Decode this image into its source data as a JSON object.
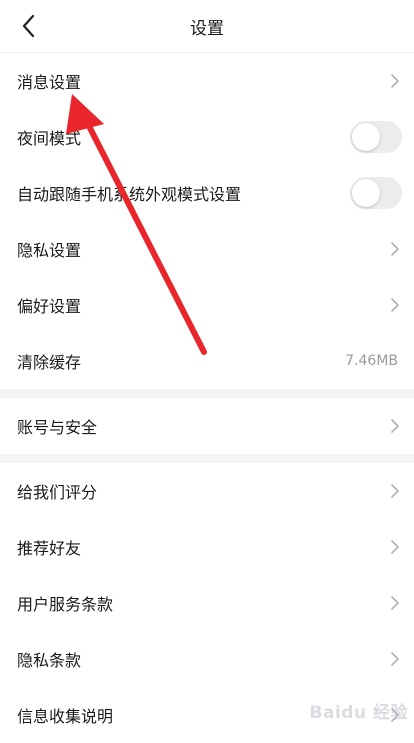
{
  "header": {
    "title": "设置",
    "back_icon": "chevron-left-icon"
  },
  "group1": [
    {
      "label": "消息设置",
      "type": "link"
    },
    {
      "label": "夜间模式",
      "type": "toggle",
      "on": false
    },
    {
      "label": "自动跟随手机系统外观模式设置",
      "type": "toggle",
      "on": false
    },
    {
      "label": "隐私设置",
      "type": "link"
    },
    {
      "label": "偏好设置",
      "type": "link"
    },
    {
      "label": "清除缓存",
      "type": "value",
      "value": "7.46MB"
    }
  ],
  "group2": [
    {
      "label": "账号与安全",
      "type": "link"
    }
  ],
  "group3": [
    {
      "label": "给我们评分",
      "type": "link"
    },
    {
      "label": "推荐好友",
      "type": "link"
    },
    {
      "label": "用户服务条款",
      "type": "link"
    },
    {
      "label": "隐私条款",
      "type": "link"
    },
    {
      "label": "信息收集说明",
      "type": "link"
    }
  ],
  "annotation": {
    "color": "#e8262b"
  },
  "watermark": {
    "text": "Baidu 经验"
  }
}
